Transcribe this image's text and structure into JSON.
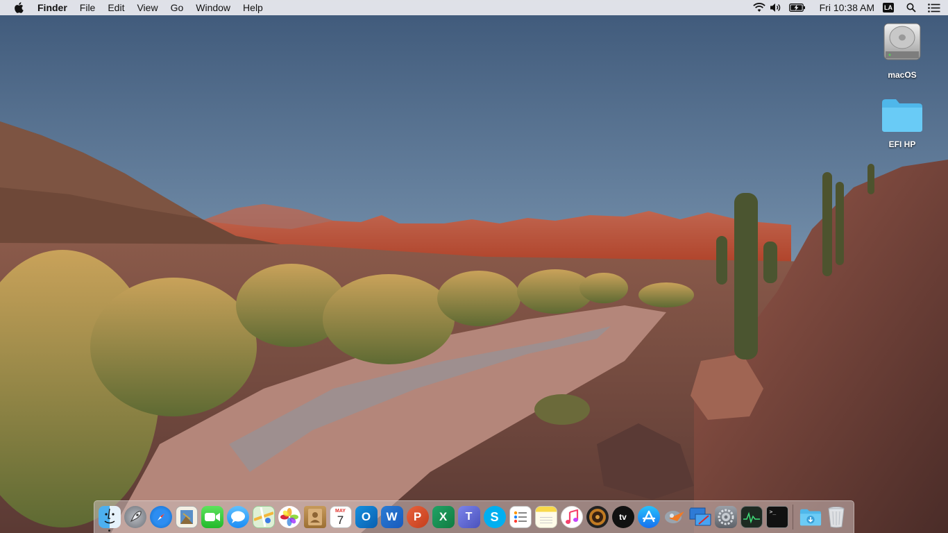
{
  "menubar": {
    "apple_icon": "apple-logo-icon",
    "app_name": "Finder",
    "menus": [
      "File",
      "Edit",
      "View",
      "Go",
      "Window",
      "Help"
    ],
    "status": {
      "wifi_icon": "wifi-icon",
      "volume_icon": "volume-icon",
      "battery_icon": "battery-charging-icon",
      "clock": "Fri 10:38 AM",
      "user_initials": "LA",
      "spotlight_icon": "search-icon",
      "notification_icon": "notification-center-icon"
    }
  },
  "desktop": {
    "icons": [
      {
        "label": "macOS",
        "icon": "hard-drive-icon"
      },
      {
        "label": "EFI HP",
        "icon": "folder-icon"
      }
    ]
  },
  "dock": {
    "apps": [
      {
        "name": "Finder",
        "icon": "finder-icon",
        "running": true
      },
      {
        "name": "Launchpad",
        "icon": "launchpad-icon"
      },
      {
        "name": "Safari",
        "icon": "safari-icon"
      },
      {
        "name": "Preview",
        "icon": "preview-icon"
      },
      {
        "name": "FaceTime",
        "icon": "facetime-icon"
      },
      {
        "name": "Messages",
        "icon": "messages-icon"
      },
      {
        "name": "Maps",
        "icon": "maps-icon"
      },
      {
        "name": "Photos",
        "icon": "photos-icon"
      },
      {
        "name": "Contacts",
        "icon": "contacts-icon"
      },
      {
        "name": "Calendar",
        "icon": "calendar-icon",
        "month": "MAY",
        "day": "7"
      },
      {
        "name": "Outlook",
        "icon": "outlook-icon",
        "letter": "O"
      },
      {
        "name": "Word",
        "icon": "word-icon",
        "letter": "W"
      },
      {
        "name": "PowerPoint",
        "icon": "powerpoint-icon",
        "letter": "P"
      },
      {
        "name": "Excel",
        "icon": "excel-icon",
        "letter": "X"
      },
      {
        "name": "Teams",
        "icon": "teams-icon",
        "letter": "T"
      },
      {
        "name": "Skype",
        "icon": "skype-icon",
        "letter": "S"
      },
      {
        "name": "Reminders",
        "icon": "reminders-icon"
      },
      {
        "name": "Notes",
        "icon": "notes-icon"
      },
      {
        "name": "iTunes",
        "icon": "itunes-icon"
      },
      {
        "name": "Audio Player",
        "icon": "speaker-icon"
      },
      {
        "name": "TV",
        "icon": "apple-tv-icon",
        "label": "tv"
      },
      {
        "name": "App Store",
        "icon": "app-store-icon"
      },
      {
        "name": "Mail Utility",
        "icon": "rocket-utility-icon"
      },
      {
        "name": "Remote Desktop",
        "icon": "remote-desktop-icon"
      },
      {
        "name": "System Preferences",
        "icon": "system-preferences-icon"
      },
      {
        "name": "Activity Monitor",
        "icon": "activity-monitor-icon"
      },
      {
        "name": "Terminal",
        "icon": "terminal-icon",
        "prompt": ">_"
      }
    ],
    "stacks": [
      {
        "name": "Downloads",
        "icon": "downloads-folder-icon"
      },
      {
        "name": "Trash",
        "icon": "trash-icon"
      }
    ]
  },
  "colors": {
    "menubar_bg": "#ececf0",
    "sky_top": "#3e5879",
    "sky_horizon": "#c9a489",
    "mountains": "#c4553a",
    "folder_blue": "#5ac8f5"
  }
}
